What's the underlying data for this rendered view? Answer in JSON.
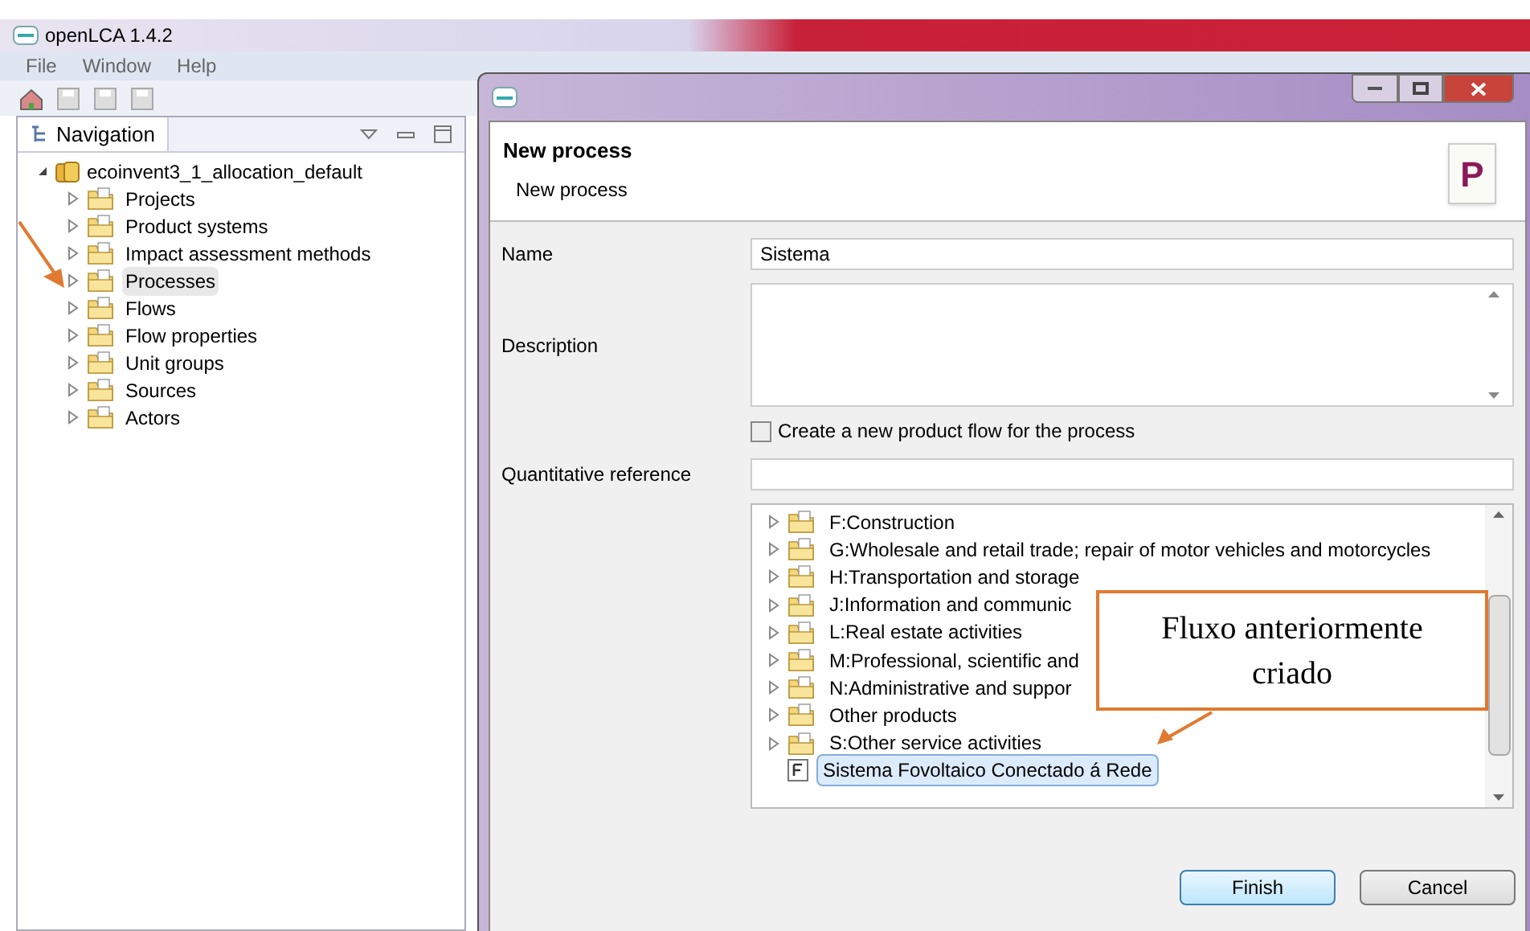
{
  "app": {
    "title": "openLCA 1.4.2",
    "menu": [
      "File",
      "Window",
      "Help"
    ]
  },
  "navigation": {
    "title": "Navigation",
    "root": {
      "label": "ecoinvent3_1_allocation_default",
      "expanded": true,
      "children": [
        {
          "label": "Projects",
          "selected": false
        },
        {
          "label": "Product systems",
          "selected": false
        },
        {
          "label": "Impact assessment methods",
          "selected": false
        },
        {
          "label": "Processes",
          "selected": true
        },
        {
          "label": "Flows",
          "selected": false
        },
        {
          "label": "Flow properties",
          "selected": false
        },
        {
          "label": "Unit groups",
          "selected": false
        },
        {
          "label": "Sources",
          "selected": false
        },
        {
          "label": "Actors",
          "selected": false
        }
      ]
    }
  },
  "dialog": {
    "title": "New process",
    "subtitle": "New process",
    "icon_letter": "P",
    "fields": [
      {
        "label": "Name",
        "value": "Sistema"
      },
      {
        "label": "Description"
      }
    ],
    "create_flow": {
      "label": "Create a new product flow for the process",
      "checked": false
    },
    "quantitative_reference": {
      "label": "Quantitative reference"
    },
    "tree": [
      {
        "kind": "folder",
        "label": "F:Construction",
        "selected": false
      },
      {
        "kind": "folder",
        "label": "G:Wholesale and retail trade; repair of motor vehicles and motorcycles",
        "selected": false
      },
      {
        "kind": "folder",
        "label": "H:Transportation and storage",
        "selected": false
      },
      {
        "kind": "folder",
        "label": "J:Information and communic",
        "selected": false
      },
      {
        "kind": "folder",
        "label": "L:Real estate activities",
        "selected": false
      },
      {
        "kind": "folder",
        "label": "M:Professional, scientific and",
        "selected": false
      },
      {
        "kind": "folder",
        "label": "N:Administrative and suppor",
        "selected": false
      },
      {
        "kind": "folder",
        "label": "Other products",
        "selected": false
      },
      {
        "kind": "folder",
        "label": "S:Other service activities",
        "selected": false
      },
      {
        "kind": "flow",
        "label": "Sistema Fovoltaico Conectado á Rede",
        "selected": true
      }
    ],
    "buttons": [
      "Finish",
      "Cancel"
    ]
  },
  "annotation": {
    "text": "Fluxo anteriormente criado"
  }
}
